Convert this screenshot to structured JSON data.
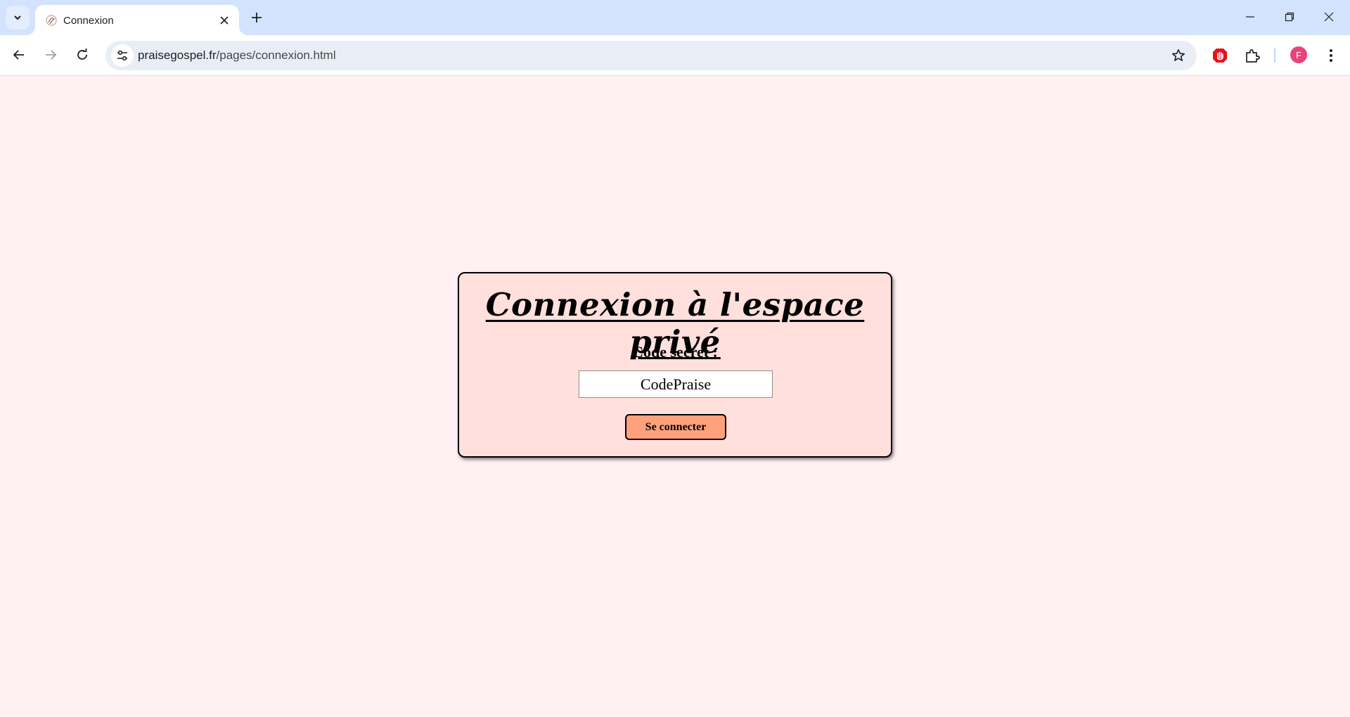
{
  "browser": {
    "tab": {
      "title": "Connexion"
    },
    "address_bar": {
      "domain": "praisegospel.fr",
      "path": "/pages/connexion.html"
    },
    "profile": {
      "initial": "F",
      "color": "#e8437a"
    }
  },
  "page": {
    "title": "Connexion à l'espace privé",
    "code_label": "Code secret :",
    "code_value": "CodePraise",
    "submit_label": "Se connecter",
    "background_color": "#fff0f3",
    "card_color": "#ffe0dc",
    "button_color": "#ffa17c"
  }
}
